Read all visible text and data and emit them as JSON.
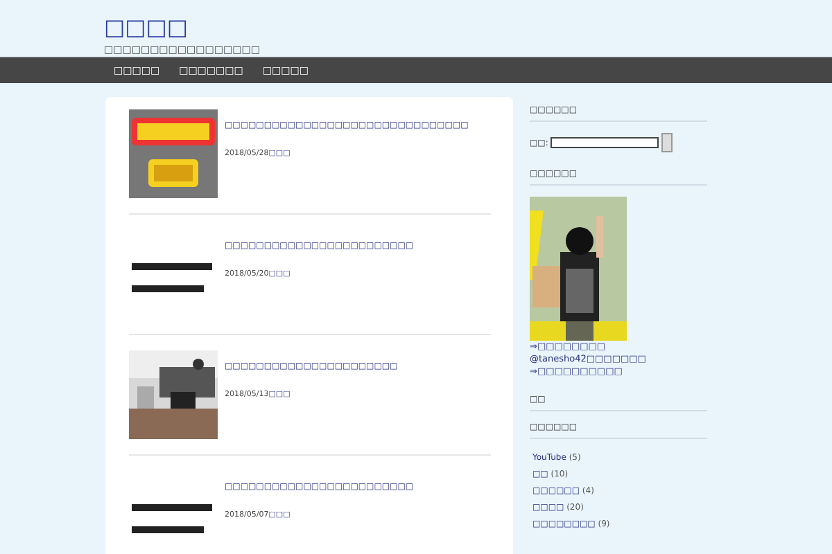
{
  "site": {
    "title": "□□□□",
    "tagline": "□□□□□□□□□□□□□□□□□"
  },
  "nav": [
    {
      "label": "□□□□□"
    },
    {
      "label": "□□□□□□□"
    },
    {
      "label": "□□□□□"
    }
  ],
  "posts": [
    {
      "title": "□□□□□□□□□□□□□□□□□□□□□□□□□□□□□□□",
      "date": "2018/05/28",
      "category": "□□□"
    },
    {
      "title": "□□□□□□□□□□□□□□□□□□□□□□□□",
      "date": "2018/05/20",
      "category": "□□□"
    },
    {
      "title": "□□□□□□□□□□□□□□□□□□□□□□",
      "date": "2018/05/13",
      "category": "□□□"
    },
    {
      "title": "□□□□□□□□□□□□□□□□□□□□□□□□",
      "date": "2018/05/07",
      "category": "□□□"
    }
  ],
  "sidebar": {
    "search_heading": "□□□□□□",
    "search_label": "□□:",
    "profile_heading": "□□□□□□",
    "profile_links": [
      "⇒□□□□□□□□",
      "@tanesho42□□□□□□□",
      "⇒□□□□□□□□□□"
    ],
    "heading_3": "□□",
    "categories_heading": "□□□□□□",
    "categories": [
      {
        "name": "YouTube",
        "count": "(5)"
      },
      {
        "name": "□□",
        "count": "(10)"
      },
      {
        "name": "□□□□□□",
        "count": "(4)"
      },
      {
        "name": "□□□□",
        "count": "(20)"
      },
      {
        "name": "□□□□□□□□",
        "count": "(9)"
      }
    ]
  }
}
